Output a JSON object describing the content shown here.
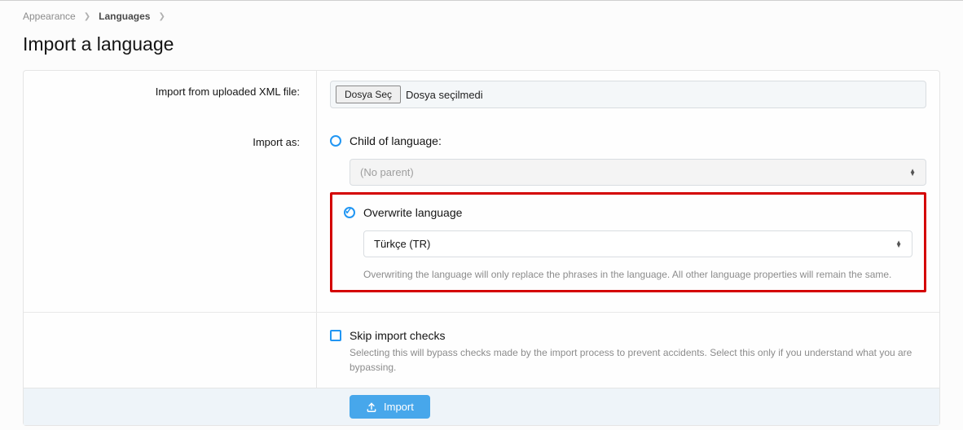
{
  "breadcrumb": {
    "parent": "Appearance",
    "current": "Languages"
  },
  "title": "Import a language",
  "rows": {
    "file": {
      "label": "Import from uploaded XML file:",
      "button": "Dosya Seç",
      "status": "Dosya seçilmedi"
    },
    "importAs": {
      "label": "Import as:",
      "child": {
        "label": "Child of language:",
        "select": "(No parent)"
      },
      "overwrite": {
        "label": "Overwrite language",
        "select": "Türkçe (TR)",
        "hint": "Overwriting the language will only replace the phrases in the language. All other language properties will remain the same."
      }
    },
    "skip": {
      "label": "Skip import checks",
      "hint": "Selecting this will bypass checks made by the import process to prevent accidents. Select this only if you understand what you are bypassing."
    }
  },
  "footer": {
    "submit": "Import"
  }
}
